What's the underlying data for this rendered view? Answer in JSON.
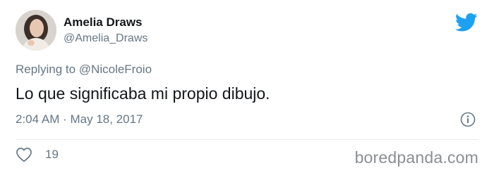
{
  "author": {
    "display_name": "Amelia Draws",
    "handle": "@Amelia_Draws",
    "avatar_icon": "profile-photo"
  },
  "reply": {
    "prefix": "Replying to",
    "target": "@NicoleFroio"
  },
  "tweet": {
    "text": "Lo que significaba mi propio dibujo.",
    "timestamp": "2:04 AM · May 18, 2017"
  },
  "engagement": {
    "likes": "19",
    "like_icon": "heart-icon",
    "info_icon": "info-icon"
  },
  "branding": {
    "platform_icon": "twitter-bird-icon",
    "watermark": "boredpanda.com"
  },
  "colors": {
    "twitter_blue": "#1da1f2",
    "text_primary": "#14171a",
    "text_secondary": "#657786",
    "divider": "#e6ecf0"
  }
}
